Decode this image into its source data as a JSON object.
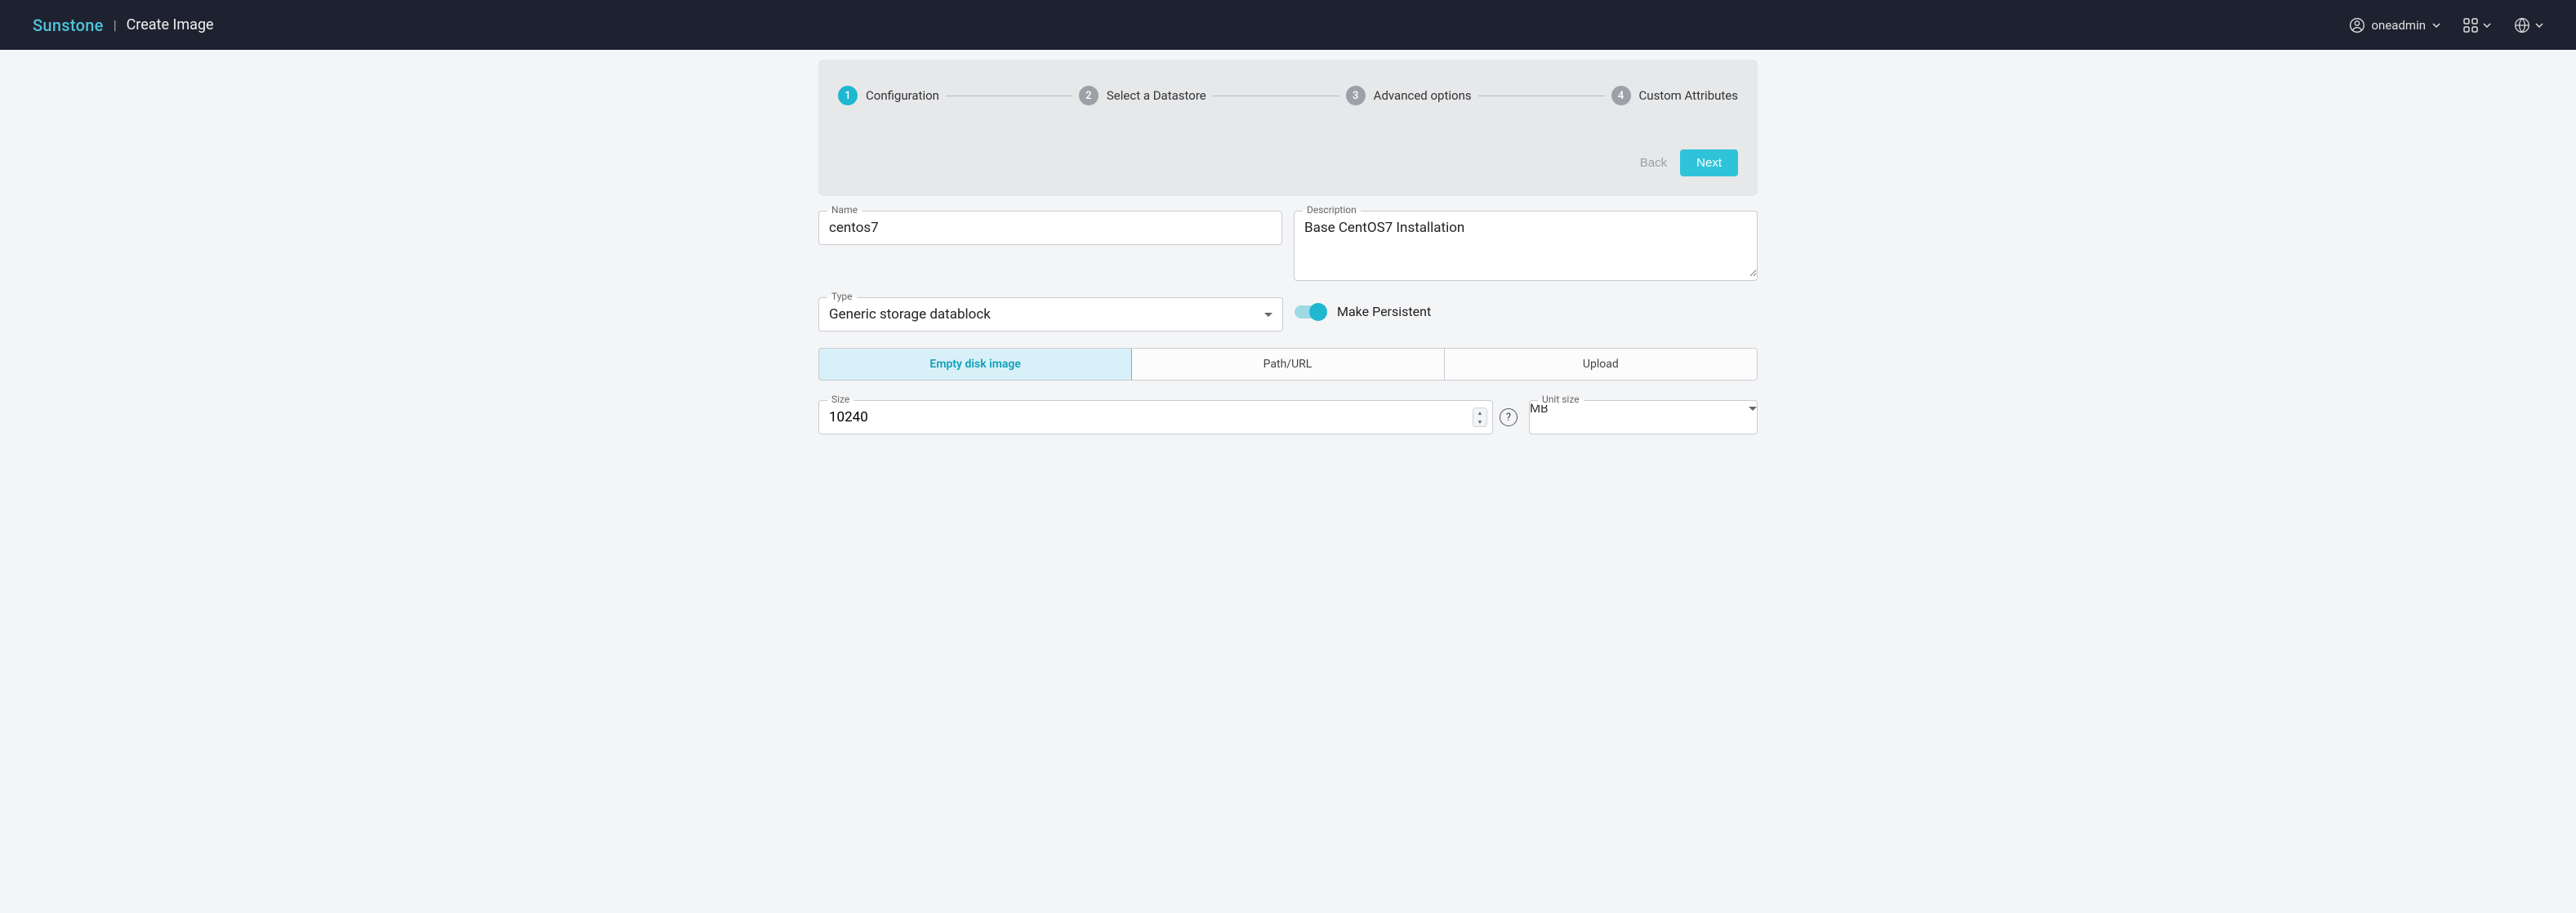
{
  "header": {
    "brand": "Sunstone",
    "page_title": "Create Image",
    "username": "oneadmin"
  },
  "stepper": {
    "steps": [
      {
        "num": "1",
        "label": "Configuration",
        "active": true
      },
      {
        "num": "2",
        "label": "Select a Datastore",
        "active": false
      },
      {
        "num": "3",
        "label": "Advanced options",
        "active": false
      },
      {
        "num": "4",
        "label": "Custom Attributes",
        "active": false
      }
    ],
    "back_label": "Back",
    "next_label": "Next"
  },
  "form": {
    "name": {
      "label": "Name",
      "value": "centos7"
    },
    "description": {
      "label": "Description",
      "value": "Base CentOS7 Installation"
    },
    "type": {
      "label": "Type",
      "value": "Generic storage datablock"
    },
    "persistent": {
      "label": "Make Persistent",
      "on": true
    },
    "source_tabs": [
      {
        "label": "Empty disk image",
        "active": true
      },
      {
        "label": "Path/URL",
        "active": false
      },
      {
        "label": "Upload",
        "active": false
      }
    ],
    "size": {
      "label": "Size",
      "value": "10240"
    },
    "unit": {
      "label": "Unit size",
      "value": "MB"
    }
  }
}
